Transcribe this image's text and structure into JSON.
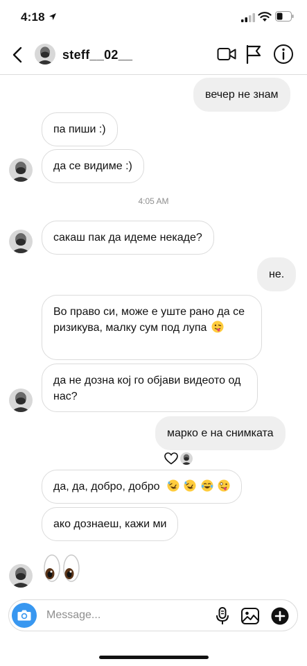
{
  "status_bar": {
    "time": "4:18"
  },
  "header": {
    "username": "steff__02__"
  },
  "messages": [
    {
      "text": "вечер не знам"
    },
    {
      "text": "па пиши :)"
    },
    {
      "text": "да се видиме :)"
    },
    {
      "text": "сакаш пак да идеме некаде?"
    },
    {
      "text": "не."
    },
    {
      "text": "Во право си, може е уште рано да се ризикува, малку сум под лупа"
    },
    {
      "text": "да не дозна кој го објави видеото од нас?"
    },
    {
      "text": "марко е на снимката"
    },
    {
      "text": "да, да, добро, добро"
    },
    {
      "text": "ако дознаеш, кажи ми"
    }
  ],
  "timestamp": "4:05 AM",
  "composer": {
    "placeholder": "Message..."
  },
  "colors": {
    "accent": "#3897f0",
    "bubble_out": "#efefef",
    "bubble_in_border": "#dbdbdb"
  },
  "icons": [
    "back-icon",
    "video-call-icon",
    "flag-icon",
    "info-icon",
    "camera-icon",
    "mic-icon",
    "gallery-icon",
    "plus-icon",
    "heart-icon"
  ]
}
